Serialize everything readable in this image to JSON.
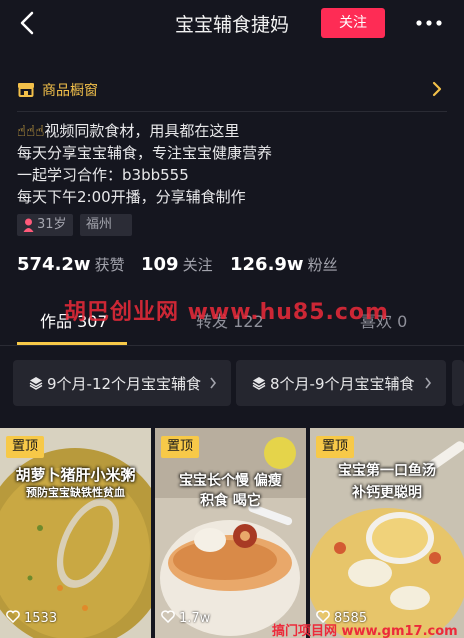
{
  "header": {
    "title": "宝宝辅食捷妈",
    "follow_label": "关注",
    "back_icon": "back-arrow-icon",
    "more_icon": "more-dots-icon"
  },
  "shop": {
    "label": "商品橱窗",
    "accent": "#f2c04a"
  },
  "bio": {
    "line1_emoji": "☝☝☝",
    "line1": "视频同款食材，用具都在这里",
    "line2": "每天分享宝宝辅食，专注宝宝健康营养",
    "line3": "一起学习合作：b3bb555",
    "line4": "每天下午2:00开播，分享辅食制作"
  },
  "tags": {
    "age": "31岁",
    "city": "福州"
  },
  "stats": {
    "likes_num": "574.2w",
    "likes_label": "获赞",
    "following_num": "109",
    "following_label": "关注",
    "followers_num": "126.9w",
    "followers_label": "粉丝"
  },
  "watermark": "胡巴创业网  www.hu85.com",
  "tabs": [
    {
      "label": "作品 307"
    },
    {
      "label": "转发 122"
    },
    {
      "label": "喜欢 0"
    }
  ],
  "collections": [
    {
      "label": "9个月-12个月宝宝辅食"
    },
    {
      "label": "8个月-9个月宝宝辅食"
    }
  ],
  "videos": [
    {
      "badge": "置顶",
      "title1": "胡萝卜猪肝小米粥",
      "title2": "预防宝宝缺铁性贫血",
      "likes": "1533"
    },
    {
      "badge": "置顶",
      "title1": "宝宝长个慢 偏瘦",
      "title2": "积食 喝它",
      "likes": "1.7w"
    },
    {
      "badge": "置顶",
      "title1": "宝宝第一口鱼汤",
      "title2": "补钙更聪明",
      "likes": "8585"
    }
  ],
  "footer_watermark": "搞门项目网  www.gm17.com",
  "colors": {
    "background": "#15161f",
    "follow_button": "#fe2c55",
    "tab_indicator": "#f7c948",
    "pin_badge": "#f7c948"
  }
}
